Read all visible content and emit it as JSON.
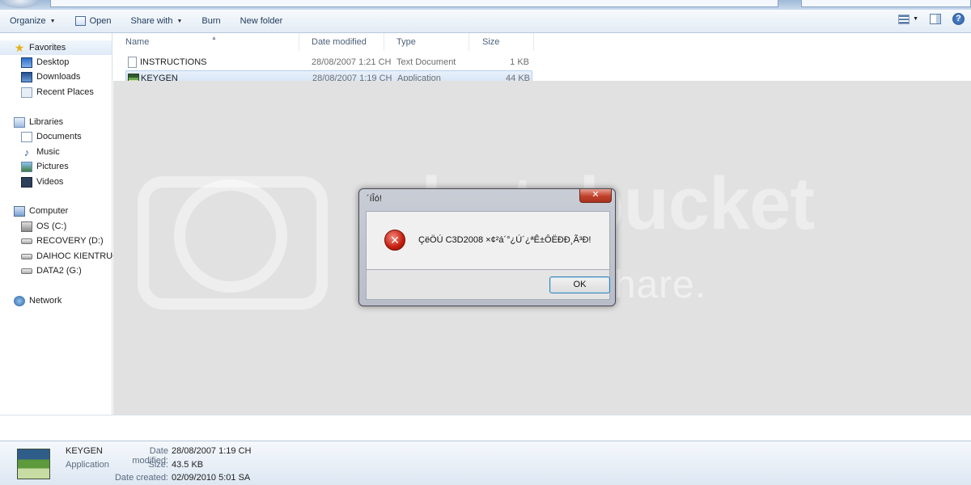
{
  "toolbar": {
    "organize": "Organize",
    "open": "Open",
    "share_with": "Share with",
    "burn": "Burn",
    "new_folder": "New folder"
  },
  "sidebar": {
    "favorites": {
      "label": "Favorites",
      "items": [
        "Desktop",
        "Downloads",
        "Recent Places"
      ]
    },
    "libraries": {
      "label": "Libraries",
      "items": [
        "Documents",
        "Music",
        "Pictures",
        "Videos"
      ]
    },
    "computer": {
      "label": "Computer",
      "items": [
        "OS (C:)",
        "RECOVERY (D:)",
        "DAIHOC KIENTRUC",
        "DATA2 (G:)"
      ]
    },
    "network": "Network"
  },
  "columns": {
    "name": "Name",
    "date": "Date modified",
    "type": "Type",
    "size": "Size"
  },
  "files": [
    {
      "name": "INSTRUCTIONS",
      "date": "28/08/2007 1:21 CH",
      "type": "Text Document",
      "size": "1 KB",
      "icon": "text-file-icon"
    },
    {
      "name": "KEYGEN",
      "date": "28/08/2007 1:19 CH",
      "type": "Application",
      "size": "44 KB",
      "icon": "application-icon"
    }
  ],
  "watermark": {
    "line1": "photobucket",
    "line2": "host. store. share."
  },
  "dialog": {
    "title": "´íÎó!",
    "message": "ÇëÖÚ C3D2008 ×¢²á´°¿Ú´¿ªÊ±ÔËÐÐ¸Ã³Ð!",
    "ok": "OK",
    "close": "✕",
    "icon": "error-icon"
  },
  "details": {
    "name": "KEYGEN",
    "type": "Application",
    "modified_label": "Date modified:",
    "modified_value": "28/08/2007 1:19 CH",
    "size_label": "Size:",
    "size_value": "43.5 KB",
    "created_label": "Date created:",
    "created_value": "02/09/2010 5:01 SA"
  },
  "colors": {
    "toolbar_text": "#1e395b",
    "selection": "#d5e4f6",
    "close_button": "#c0402a",
    "error_red": "#c41e10"
  }
}
